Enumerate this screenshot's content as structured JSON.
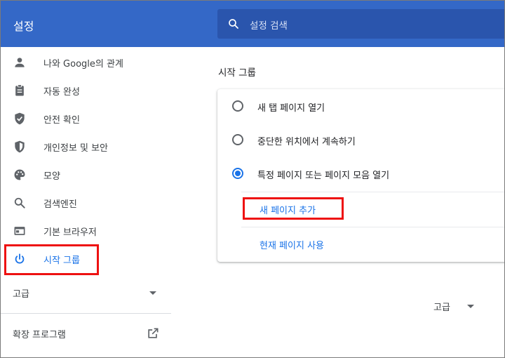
{
  "header": {
    "title": "설정",
    "search_placeholder": "설정 검색"
  },
  "sidebar": {
    "items": [
      {
        "label": "나와 Google의 관계",
        "icon": "person-icon"
      },
      {
        "label": "자동 완성",
        "icon": "clipboard-icon"
      },
      {
        "label": "안전 확인",
        "icon": "shield-check-icon"
      },
      {
        "label": "개인정보 및 보안",
        "icon": "shield-half-icon"
      },
      {
        "label": "모양",
        "icon": "palette-icon"
      },
      {
        "label": "검색엔진",
        "icon": "search-icon"
      },
      {
        "label": "기본 브라우저",
        "icon": "browser-window-icon"
      },
      {
        "label": "시작 그룹",
        "icon": "power-icon",
        "active": true
      }
    ],
    "advanced_label": "고급",
    "extensions_label": "확장 프로그램",
    "extensions_icon": "open-in-new-icon"
  },
  "main": {
    "section_title": "시작 그룹",
    "options": [
      {
        "label": "새 탭 페이지 열기",
        "checked": false
      },
      {
        "label": "중단한 위치에서 계속하기",
        "checked": false
      },
      {
        "label": "특정 페이지 또는 페이지 모음 열기",
        "checked": true
      }
    ],
    "add_page_link": "새 페이지 추가",
    "use_current_link": "현재 페이지 사용",
    "advanced_label": "고급"
  },
  "colors": {
    "header_bg": "#3468c7",
    "search_bg": "#2a55ad",
    "accent": "#1a73e8",
    "highlight": "#ee1111"
  }
}
